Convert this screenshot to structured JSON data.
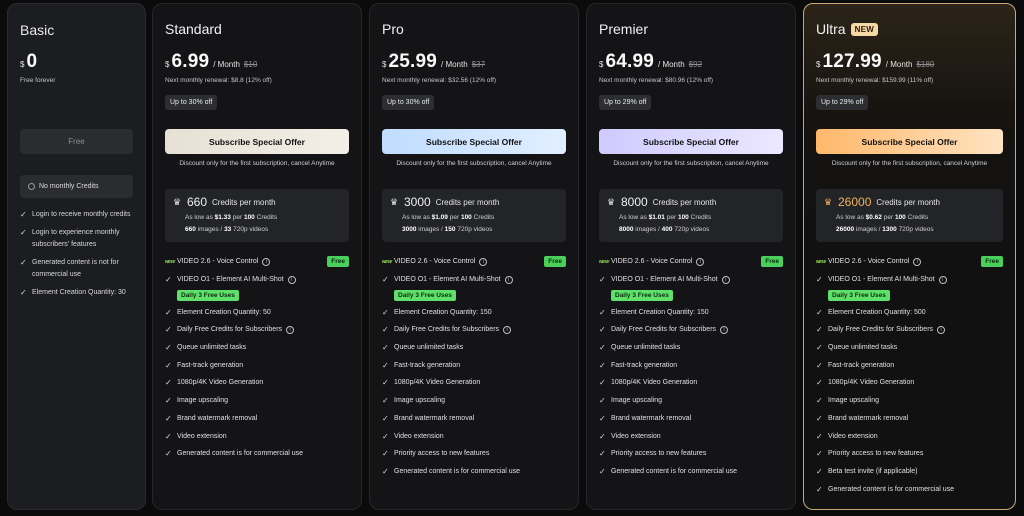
{
  "basic": {
    "name": "Basic",
    "currency": "$",
    "amount": "0",
    "note": "Free forever",
    "button": "Free",
    "no_credits": "No monthly Credits",
    "features": [
      "Login to receive monthly credits",
      "Login to experience monthly subscribers' features",
      "Generated content is not for commercial use",
      "Element Creation Quantity: 30"
    ]
  },
  "plans": [
    {
      "id": "standard",
      "name": "Standard",
      "currency": "$",
      "amount": "6.99",
      "per": "/ Month",
      "old": "$10",
      "renewal": "Next monthly renewal: $8.8 (12% off)",
      "discount": "Up to 30% off",
      "cta": "Subscribe Special Offer",
      "cta_note": "Discount only for the first subscription, cancel Anytime",
      "credits": "660",
      "credits_unit": "Credits per month",
      "as_low_prefix": "As low as",
      "as_low_price": "$1.33",
      "as_low_mid": "per",
      "as_low_qty": "100",
      "as_low_suffix": "Credits",
      "images": "660",
      "images_label": "images /",
      "videos": "33",
      "videos_label": "720p videos",
      "features": [
        {
          "text": "VIDEO 2.6 - Voice Control",
          "new": true,
          "info": true,
          "free": true
        },
        {
          "text": "VIDEO O1 - Element AI Multi-Shot",
          "info": true
        },
        {
          "uses": "Daily 3 Free Uses"
        },
        {
          "text": "Element Creation Quantity: 50"
        },
        {
          "text": "Daily Free Credits for Subscribers",
          "info": true
        },
        {
          "text": "Queue unlimited tasks"
        },
        {
          "text": "Fast-track generation"
        },
        {
          "text": "1080p/4K Video Generation"
        },
        {
          "text": "Image upscaling"
        },
        {
          "text": "Brand watermark removal"
        },
        {
          "text": "Video extension"
        },
        {
          "text": "Generated content is for commercial use"
        }
      ]
    },
    {
      "id": "pro",
      "name": "Pro",
      "currency": "$",
      "amount": "25.99",
      "per": "/ Month",
      "old": "$37",
      "renewal": "Next monthly renewal: $32.56 (12% off)",
      "discount": "Up to 30% off",
      "cta": "Subscribe Special Offer",
      "cta_note": "Discount only for the first subscription, cancel Anytime",
      "credits": "3000",
      "credits_unit": "Credits per month",
      "as_low_prefix": "As low as",
      "as_low_price": "$1.09",
      "as_low_mid": "per",
      "as_low_qty": "100",
      "as_low_suffix": "Credits",
      "images": "3000",
      "images_label": "images /",
      "videos": "150",
      "videos_label": "720p videos",
      "features": [
        {
          "text": "VIDEO 2.6 - Voice Control",
          "new": true,
          "info": true,
          "free": true
        },
        {
          "text": "VIDEO O1 - Element AI Multi-Shot",
          "info": true
        },
        {
          "uses": "Daily 3 Free Uses"
        },
        {
          "text": "Element Creation Quantity: 150"
        },
        {
          "text": "Daily Free Credits for Subscribers",
          "info": true
        },
        {
          "text": "Queue unlimited tasks"
        },
        {
          "text": "Fast-track generation"
        },
        {
          "text": "1080p/4K Video Generation"
        },
        {
          "text": "Image upscaling"
        },
        {
          "text": "Brand watermark removal"
        },
        {
          "text": "Video extension"
        },
        {
          "text": "Priority access to new features"
        },
        {
          "text": "Generated content is for commercial use"
        }
      ]
    },
    {
      "id": "premier",
      "name": "Premier",
      "currency": "$",
      "amount": "64.99",
      "per": "/ Month",
      "old": "$92",
      "renewal": "Next monthly renewal: $80.96 (12% off)",
      "discount": "Up to 29% off",
      "cta": "Subscribe Special Offer",
      "cta_note": "Discount only for the first subscription, cancel Anytime",
      "credits": "8000",
      "credits_unit": "Credits per month",
      "as_low_prefix": "As low as",
      "as_low_price": "$1.01",
      "as_low_mid": "per",
      "as_low_qty": "100",
      "as_low_suffix": "Credits",
      "images": "8000",
      "images_label": "images /",
      "videos": "400",
      "videos_label": "720p videos",
      "features": [
        {
          "text": "VIDEO 2.6 - Voice Control",
          "new": true,
          "info": true,
          "free": true
        },
        {
          "text": "VIDEO O1 - Element AI Multi-Shot",
          "info": true
        },
        {
          "uses": "Daily 3 Free Uses"
        },
        {
          "text": "Element Creation Quantity: 150"
        },
        {
          "text": "Daily Free Credits for Subscribers",
          "info": true
        },
        {
          "text": "Queue unlimited tasks"
        },
        {
          "text": "Fast-track generation"
        },
        {
          "text": "1080p/4K Video Generation"
        },
        {
          "text": "Image upscaling"
        },
        {
          "text": "Brand watermark removal"
        },
        {
          "text": "Video extension"
        },
        {
          "text": "Priority access to new features"
        },
        {
          "text": "Generated content is for commercial use"
        }
      ]
    },
    {
      "id": "ultra",
      "name": "Ultra",
      "badge": "NEW",
      "currency": "$",
      "amount": "127.99",
      "per": "/ Month",
      "old": "$180",
      "renewal": "Next monthly renewal: $159.99 (11% off)",
      "discount": "Up to 29% off",
      "cta": "Subscribe Special Offer",
      "cta_note": "Discount only for the first subscription, cancel Anytime",
      "credits": "26000",
      "credits_unit": "Credits per month",
      "as_low_prefix": "As low as",
      "as_low_price": "$0.62",
      "as_low_mid": "per",
      "as_low_qty": "100",
      "as_low_suffix": "Credits",
      "images": "26000",
      "images_label": "images /",
      "videos": "1300",
      "videos_label": "720p videos",
      "features": [
        {
          "text": "VIDEO 2.6 - Voice Control",
          "new": true,
          "info": true,
          "free": true
        },
        {
          "text": "VIDEO O1 - Element AI Multi-Shot",
          "info": true
        },
        {
          "uses": "Daily 3 Free Uses"
        },
        {
          "text": "Element Creation Quantity: 500"
        },
        {
          "text": "Daily Free Credits for Subscribers",
          "info": true
        },
        {
          "text": "Queue unlimited tasks"
        },
        {
          "text": "Fast-track generation"
        },
        {
          "text": "1080p/4K Video Generation"
        },
        {
          "text": "Image upscaling"
        },
        {
          "text": "Brand watermark removal"
        },
        {
          "text": "Video extension"
        },
        {
          "text": "Priority access to new features"
        },
        {
          "text": "Beta test invite (if applicable)"
        },
        {
          "text": "Generated content is for commercial use"
        }
      ]
    }
  ],
  "labels": {
    "new_tag": "NEW",
    "free_tag": "Free",
    "info_glyph": "i",
    "check_glyph": "✓",
    "crown_glyph": "♛"
  }
}
